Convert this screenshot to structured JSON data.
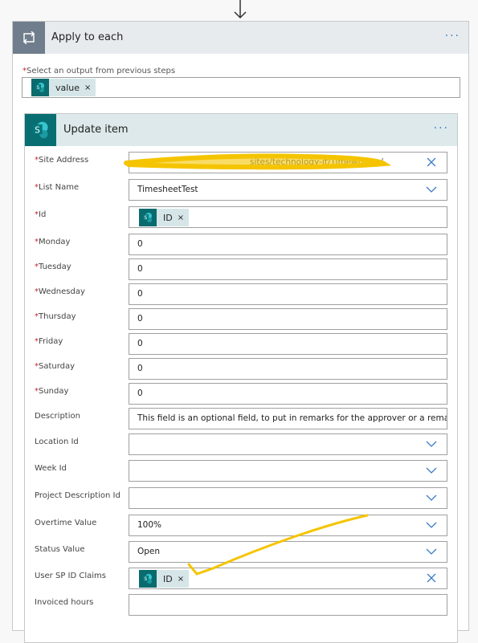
{
  "apply_to_each": {
    "title": "Apply to each",
    "more_label": "···",
    "select_label": "Select an output from previous steps",
    "token": {
      "label": "value",
      "remove": "×"
    }
  },
  "update_item": {
    "title": "Update item",
    "more_label": "···",
    "fields": [
      {
        "label": "Site Address",
        "required": "*",
        "value": "sites/technology-it/Timewriting/",
        "control": "clear"
      },
      {
        "label": "List Name",
        "required": "*",
        "value": "TimesheetTest",
        "control": "dropdown"
      },
      {
        "label": "Id",
        "required": "*",
        "value": "",
        "token": "ID",
        "control": "none"
      },
      {
        "label": "Monday",
        "required": "*",
        "value": "0",
        "control": "none"
      },
      {
        "label": "Tuesday",
        "required": "*",
        "value": "0",
        "control": "none"
      },
      {
        "label": "Wednesday",
        "required": "*",
        "value": "0",
        "control": "none"
      },
      {
        "label": "Thursday",
        "required": "*",
        "value": "0",
        "control": "none"
      },
      {
        "label": "Friday",
        "required": "*",
        "value": "0",
        "control": "none"
      },
      {
        "label": "Saturday",
        "required": "*",
        "value": "0",
        "control": "none"
      },
      {
        "label": "Sunday",
        "required": "*",
        "value": "0",
        "control": "none"
      },
      {
        "label": "Description",
        "required": "",
        "value": "This field is an optional field, to put in remarks for the approver or a remark on",
        "control": "none"
      },
      {
        "label": "Location Id",
        "required": "",
        "value": "",
        "control": "dropdown"
      },
      {
        "label": "Week Id",
        "required": "",
        "value": "",
        "control": "dropdown"
      },
      {
        "label": "Project Description Id",
        "required": "",
        "value": "",
        "control": "dropdown"
      },
      {
        "label": "Overtime Value",
        "required": "",
        "value": "100%",
        "control": "dropdown"
      },
      {
        "label": "Status Value",
        "required": "",
        "value": "Open",
        "control": "dropdown"
      },
      {
        "label": "User SP ID Claims",
        "required": "",
        "value": "",
        "token": "ID",
        "control": "clear"
      },
      {
        "label": "Invoiced hours",
        "required": "",
        "value": "",
        "control": "none"
      }
    ]
  },
  "token_remove": "×",
  "colors": {
    "sharepoint": "#096e72",
    "token_bg": "#d6e6e8",
    "accent": "#3a7dc9",
    "required": "#c0262d",
    "highlighter": "#f5c400"
  }
}
